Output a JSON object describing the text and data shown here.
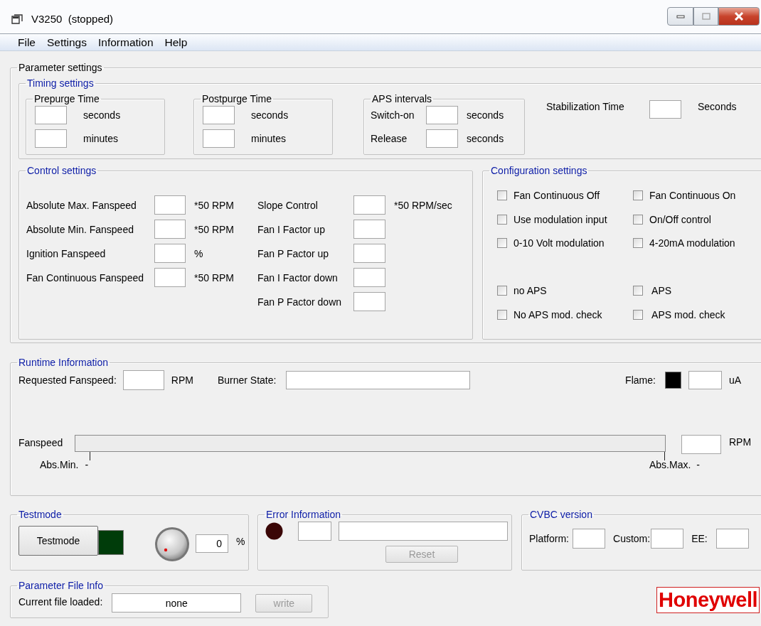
{
  "window": {
    "title": "V3250  (stopped)"
  },
  "menu": [
    {
      "label": "File"
    },
    {
      "label": "Settings"
    },
    {
      "label": "Information"
    },
    {
      "label": "Help"
    }
  ],
  "parameter_settings": {
    "title": "Parameter settings",
    "timing": {
      "title": "Timing settings",
      "groups": [
        {
          "title": "Prepurge Time",
          "rows": [
            {
              "unit": "seconds"
            },
            {
              "unit": "minutes"
            }
          ]
        },
        {
          "title": "Postpurge Time",
          "rows": [
            {
              "unit": "seconds"
            },
            {
              "unit": "minutes"
            }
          ]
        },
        {
          "title": "APS intervals",
          "rows": [
            {
              "label": "Switch-on",
              "unit": "seconds"
            },
            {
              "label": "Release",
              "unit": "seconds"
            }
          ]
        }
      ],
      "stabilization": {
        "label": "Stabilization Time",
        "unit": "Seconds"
      }
    },
    "control": {
      "title": "Control settings",
      "left": [
        {
          "label": "Absolute Max. Fanspeed",
          "unit": "*50 RPM"
        },
        {
          "label": "Absolute Min. Fanspeed",
          "unit": "*50 RPM"
        },
        {
          "label": "Ignition Fanspeed",
          "unit": "%"
        },
        {
          "label": "Fan Continuous Fanspeed",
          "unit": "*50 RPM"
        }
      ],
      "right": [
        {
          "label": "Slope Control",
          "unit": "*50 RPM/sec"
        },
        {
          "label": "Fan I Factor up"
        },
        {
          "label": "Fan P Factor up"
        },
        {
          "label": "Fan I Factor down"
        },
        {
          "label": "Fan P Factor down"
        }
      ]
    },
    "configuration": {
      "title": "Configuration settings",
      "blocks": [
        [
          {
            "label": "Fan Continuous Off",
            "checked": false
          },
          {
            "label": "Fan Continuous On",
            "checked": false
          },
          {
            "label": "Use modulation input",
            "checked": false
          },
          {
            "label": "On/Off control",
            "checked": false
          },
          {
            "label": "0-10 Volt modulation",
            "checked": false
          },
          {
            "label": "4-20mA modulation",
            "checked": false
          }
        ],
        [
          {
            "label": "no APS",
            "checked": false
          },
          {
            "label": " APS",
            "checked": false
          },
          {
            "label": "No APS mod. check",
            "checked": false
          },
          {
            "label": " APS mod. check",
            "checked": false
          }
        ]
      ]
    }
  },
  "runtime": {
    "title": "Runtime Information",
    "requested": {
      "label": "Requested Fanspeed:",
      "unit": "RPM"
    },
    "burner_state": {
      "label": "Burner State:"
    },
    "flame": {
      "label": "Flame:",
      "lit": false,
      "unit": "uA"
    },
    "fanspeed": {
      "label": "Fanspeed",
      "level": 0,
      "min_label": "Abs.Min.",
      "min_value": "-",
      "max_label": "Abs.Max.",
      "max_value": "-",
      "unit": "RPM"
    }
  },
  "testmode": {
    "title": "Testmode",
    "button": "Testmode",
    "active": false,
    "value": "0",
    "unit": "%"
  },
  "error": {
    "title": "Error Information",
    "lit": false,
    "button": {
      "label": "Reset",
      "disabled": true
    }
  },
  "cvbc": {
    "title": "CVBC version",
    "fields": [
      {
        "label": "Platform:"
      },
      {
        "label": "Custom:"
      },
      {
        "label": "EE:"
      }
    ]
  },
  "file_info": {
    "title": "Parameter File Info",
    "label": "Current file loaded:",
    "value": "none",
    "button": {
      "label": "write",
      "disabled": true
    }
  },
  "logo": "Honeywell"
}
